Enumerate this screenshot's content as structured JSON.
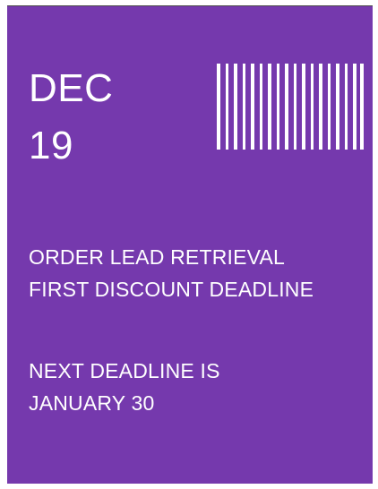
{
  "card": {
    "background": "#7539ad",
    "text_color": "#ffffff"
  },
  "date": {
    "month": "DEC",
    "day": "19"
  },
  "barcode": {
    "icon": "barcode-icon"
  },
  "message": {
    "line1": "ORDER LEAD RETRIEVAL",
    "line2": "FIRST DISCOUNT DEADLINE"
  },
  "next": {
    "line1": "NEXT DEADLINE IS",
    "line2": "JANUARY 30"
  }
}
